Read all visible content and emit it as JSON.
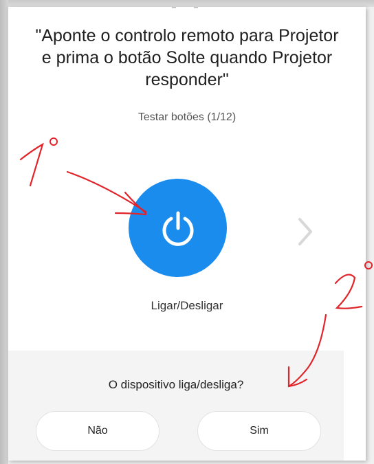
{
  "instruction": "\"Aponte o controlo remoto para Projetor\ne prima o botão Solte quando Projetor\nresponder\"",
  "counter": "Testar botões (1/12)",
  "power_button": {
    "label": "Ligar/Desligar",
    "icon": "power-icon",
    "color": "#1a8cee"
  },
  "next_icon": "chevron-right-icon",
  "question": "O dispositivo liga/desliga?",
  "answers": {
    "no": "Não",
    "yes": "Sim"
  },
  "annotations": {
    "first": "1°",
    "second": "2°",
    "color": "#e0242a"
  }
}
